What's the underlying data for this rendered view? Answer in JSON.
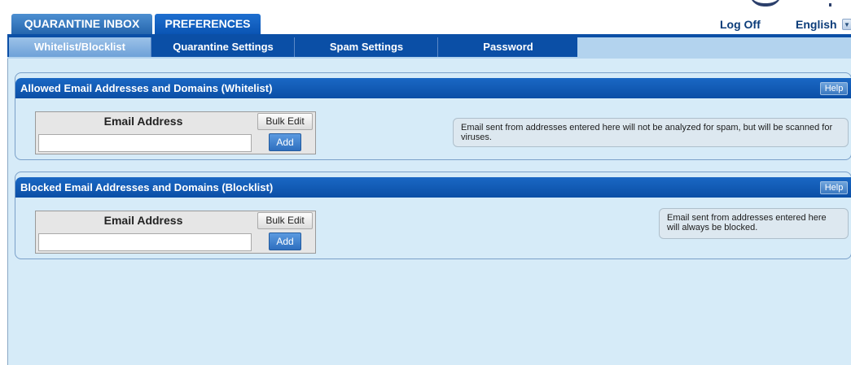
{
  "header": {
    "tabs": [
      {
        "label": "QUARANTINE INBOX",
        "active": false
      },
      {
        "label": "PREFERENCES",
        "active": true
      }
    ],
    "logoff_label": "Log Off",
    "language": "English"
  },
  "subnav": {
    "tabs": [
      {
        "label": "Whitelist/Blocklist",
        "active": true
      },
      {
        "label": "Quarantine Settings",
        "active": false
      },
      {
        "label": "Spam Settings",
        "active": false
      },
      {
        "label": "Password",
        "active": false
      }
    ]
  },
  "whitelist": {
    "title": "Allowed Email Addresses and Domains (Whitelist)",
    "help_label": "Help",
    "column_header": "Email Address",
    "bulk_edit_label": "Bulk Edit",
    "input_value": "",
    "add_label": "Add",
    "info": "Email sent from addresses entered here will not be analyzed for spam, but will be scanned for viruses."
  },
  "blocklist": {
    "title": "Blocked Email Addresses and Domains (Blocklist)",
    "help_label": "Help",
    "column_header": "Email Address",
    "bulk_edit_label": "Bulk Edit",
    "input_value": "",
    "add_label": "Add",
    "info": "Email sent from addresses entered here will always be blocked."
  },
  "colors": {
    "accent_blue": "#0b4fa6",
    "panel_background": "#d6ebf8",
    "link_color": "#0c3d7a"
  },
  "icons": {
    "language_dropdown": "chevron-down-icon"
  }
}
